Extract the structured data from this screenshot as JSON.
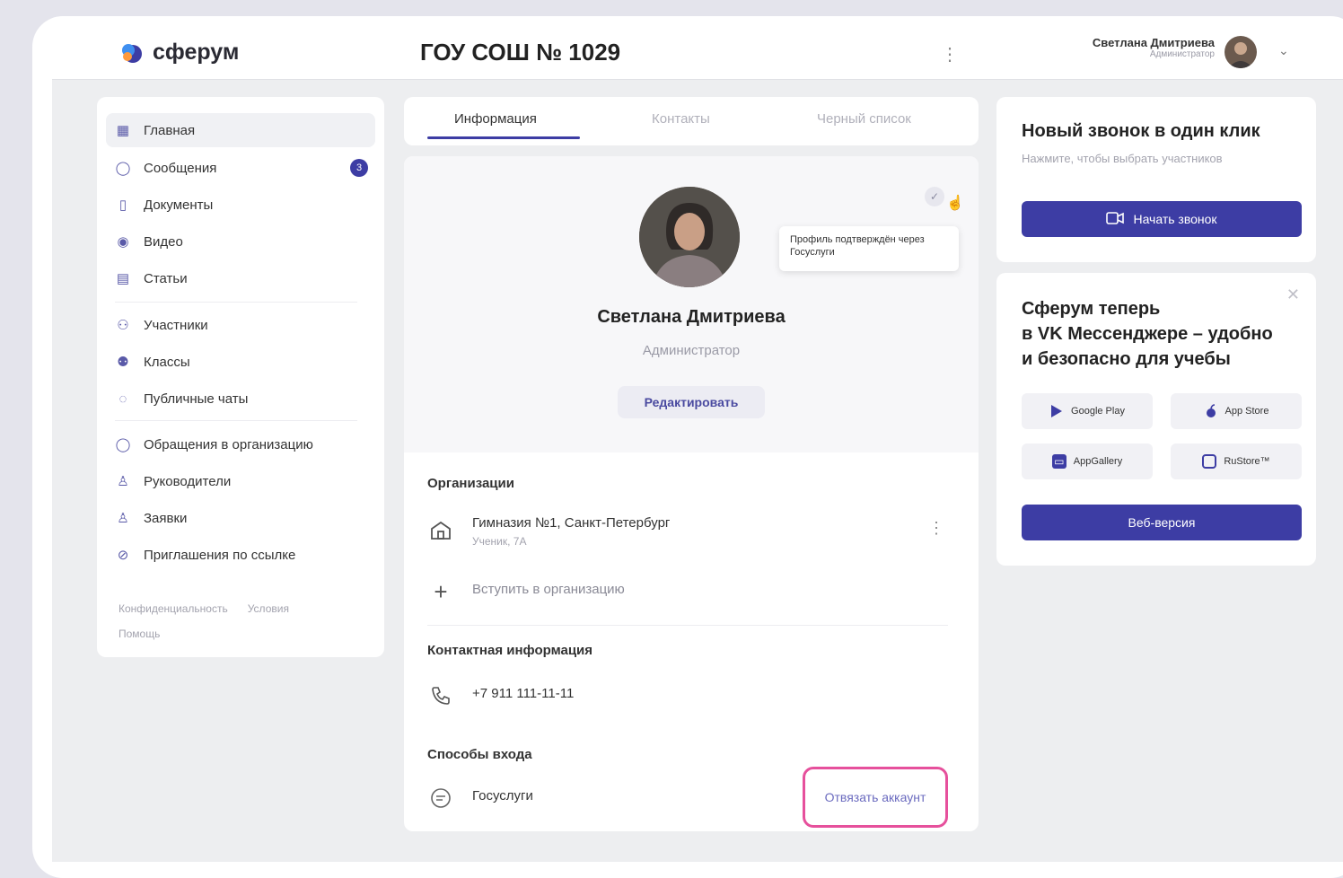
{
  "header": {
    "logo_text": "сферум",
    "org_title": "ГОУ СОШ № 1029",
    "more": "⋮",
    "user_name": "Светлана Дмитриева",
    "user_role": "Администратор"
  },
  "sidebar": {
    "items": [
      {
        "label": "Главная",
        "icon": "grid-icon",
        "glyph": "▦"
      },
      {
        "label": "Сообщения",
        "icon": "chat-icon",
        "glyph": "◯",
        "badge": "3"
      },
      {
        "label": "Документы",
        "icon": "document-icon",
        "glyph": "▯"
      },
      {
        "label": "Видео",
        "icon": "video-icon",
        "glyph": "◉"
      },
      {
        "label": "Статьи",
        "icon": "article-icon",
        "glyph": "▤"
      },
      {
        "label": "Участники",
        "icon": "participants-icon",
        "glyph": "⚇"
      },
      {
        "label": "Классы",
        "icon": "classes-icon",
        "glyph": "⚉"
      },
      {
        "label": "Публичные чаты",
        "icon": "public-chats-icon",
        "glyph": "◌"
      },
      {
        "label": "Обращения в организацию",
        "icon": "appeal-icon",
        "glyph": "◯"
      },
      {
        "label": "Руководители",
        "icon": "leaders-icon",
        "glyph": "♙"
      },
      {
        "label": "Заявки",
        "icon": "requests-icon",
        "glyph": "♙"
      },
      {
        "label": "Приглашения по ссылке",
        "icon": "invite-link-icon",
        "glyph": "⊘"
      }
    ],
    "footer_links": [
      "Конфиденциальность",
      "Условия",
      "Помощь"
    ]
  },
  "tabs": [
    "Информация",
    "Контакты",
    "Черный список"
  ],
  "profile": {
    "name": "Светлана Дмитриева",
    "role": "Администратор",
    "edit_label": "Редактировать",
    "tooltip": "Профиль подтверждён через Госуслуги"
  },
  "organizations": {
    "title": "Организации",
    "items": [
      {
        "name": "Гимназия №1, Санкт-Петербург",
        "sub": "Ученик, 7А"
      }
    ],
    "join_label": "Вступить в организацию"
  },
  "contacts": {
    "title": "Контактная информация",
    "phone": "+7 911 111-11-11"
  },
  "login": {
    "title": "Способы входа",
    "method": "Госуслуги",
    "unlink_label": "Отвязать аккаунт"
  },
  "call_card": {
    "title": "Новый звонок в один клик",
    "subtitle": "Нажмите, чтобы выбрать участников",
    "button": "Начать звонок"
  },
  "promo_card": {
    "title_lines": [
      "Сферум теперь",
      "в VK Мессенджере – удобно",
      "и безопасно для учебы"
    ],
    "stores": [
      "Google Play",
      "App Store",
      "AppGallery",
      "RuStore™"
    ],
    "web_button": "Веб-версия"
  },
  "colors": {
    "accent": "#3d3da4",
    "highlight": "#e6509c"
  }
}
